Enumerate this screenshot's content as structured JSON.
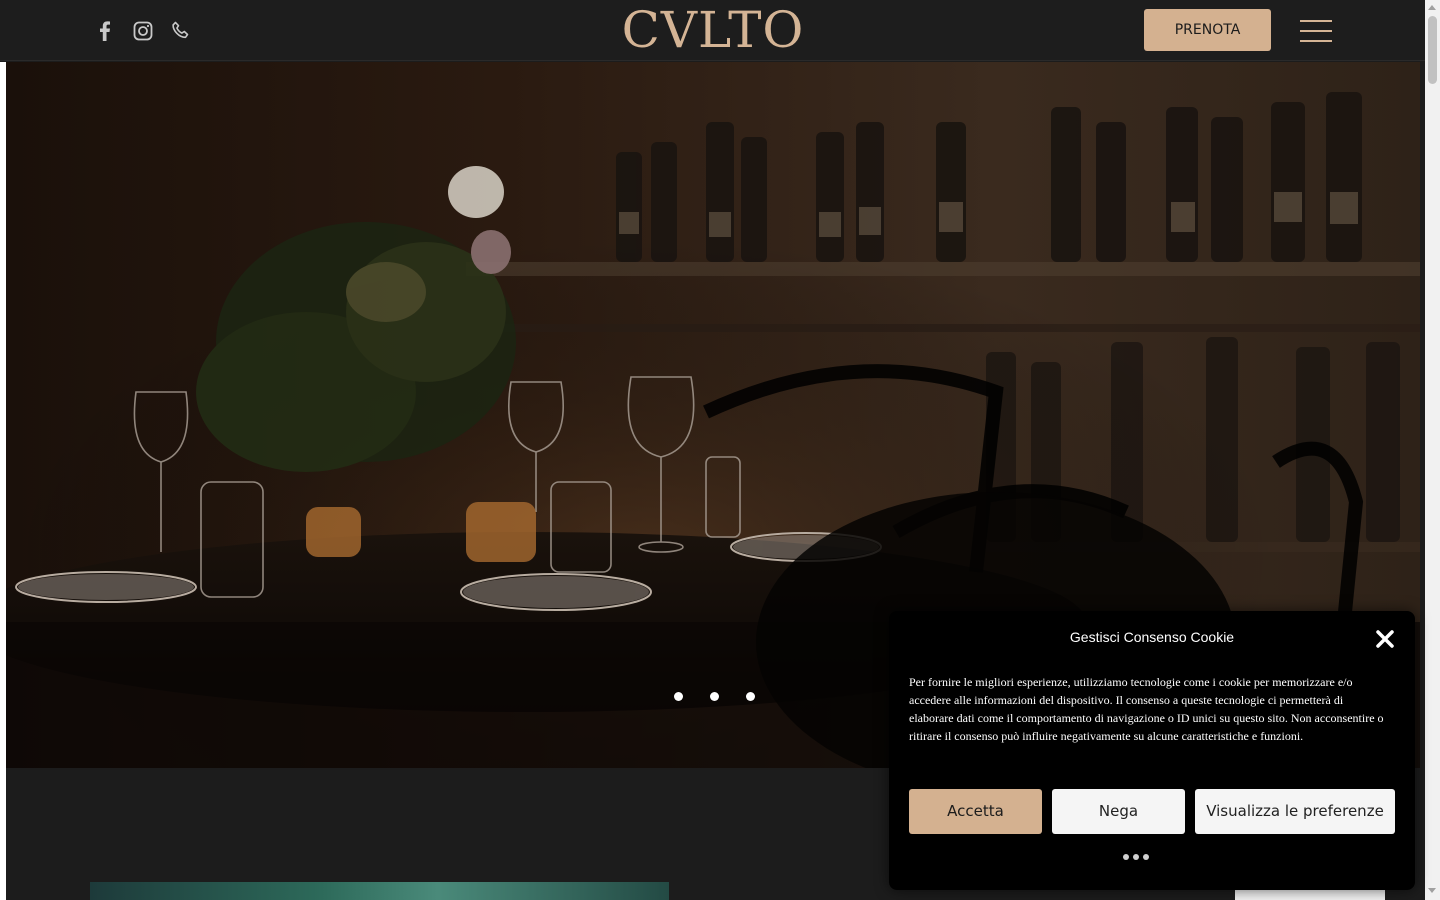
{
  "header": {
    "logo_text": "CVLTO",
    "reserve_label": "PRENOTA",
    "social_icons": [
      "facebook-icon",
      "instagram-icon",
      "phone-icon"
    ],
    "menu_icon": "hamburger-menu-icon"
  },
  "hero": {
    "slide_count": 3,
    "active_slide": 1
  },
  "cookie": {
    "title": "Gestisci Consenso Cookie",
    "text": "Per fornire le migliori esperienze, utilizziamo tecnologie come i cookie per memorizzare e/o accedere alle informazioni del dispositivo. Il consenso a queste tecnologie ci permetterà di elaborare dati come il comportamento di navigazione o ID unici su questo sito. Non acconsentire o ritirare il consenso può influire negativamente su alcune caratteristiche e funzioni.",
    "accept_label": "Accetta",
    "deny_label": "Nega",
    "prefs_label": "Visualizza le preferenze"
  },
  "colors": {
    "accent": "#d4b190",
    "header_bg": "#1d1d1d",
    "page_bg": "#1c1c1c",
    "banner_bg": "#000000"
  }
}
